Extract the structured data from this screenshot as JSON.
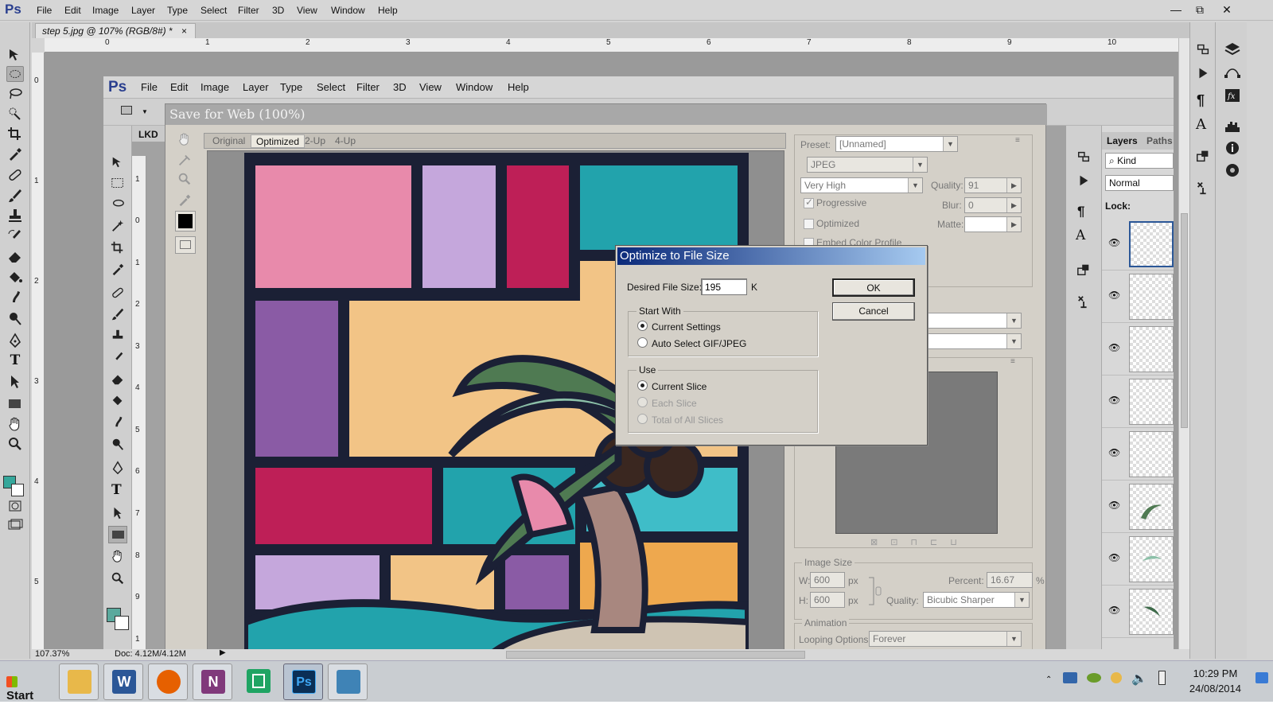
{
  "app": {
    "logo": "Ps",
    "menu": [
      "File",
      "Edit",
      "Image",
      "Layer",
      "Type",
      "Select",
      "Filter",
      "3D",
      "View",
      "Window",
      "Help"
    ],
    "window_controls": [
      "—",
      "⧉",
      "✕"
    ]
  },
  "document": {
    "tab_title": "step 5.jpg @ 107% (RGB/8#) *",
    "tab_close": "×",
    "ruler_h": [
      "0",
      "1",
      "2",
      "3",
      "4",
      "5",
      "6",
      "7",
      "8",
      "9",
      "10"
    ],
    "ruler_v": [
      "0",
      "1",
      "2",
      "3",
      "4",
      "5"
    ],
    "zoom": "107.37%",
    "doc_size": "Doc: 4.12M/4.12M"
  },
  "inner_screenshot": {
    "logo": "Ps",
    "menu": [
      "File",
      "Edit",
      "Image",
      "Layer",
      "Type",
      "Select",
      "Filter",
      "3D",
      "View",
      "Window",
      "Help"
    ],
    "lkd_label": "LKD",
    "ruler_v": [
      "1",
      "0",
      "1",
      "2",
      "3",
      "4",
      "5",
      "6",
      "7",
      "8",
      "9",
      "1"
    ],
    "layers_tab": "Layers",
    "paths_tab": "Paths",
    "kind_label": "Kind",
    "blend_mode": "Normal",
    "lock_label": "Lock:"
  },
  "save_for_web": {
    "title": "Save for Web (100%)",
    "view_tabs": [
      "Original",
      "Optimized",
      "2-Up",
      "4-Up"
    ],
    "active_tab": "Optimized",
    "preset_label": "Preset:",
    "preset_value": "[Unnamed]",
    "format_value": "JPEG",
    "quality_preset": "Very High",
    "quality_label": "Quality:",
    "quality_value": "91",
    "blur_label": "Blur:",
    "blur_value": "0",
    "matte_label": "Matte:",
    "progressive_label": "Progressive",
    "optimized_label": "Optimized",
    "embed_label": "Embed Color Profile",
    "image_size_label": "Image Size",
    "w_label": "W:",
    "w_value": "600",
    "h_label": "H:",
    "h_value": "600",
    "px_unit": "px",
    "percent_label": "Percent:",
    "percent_value": "16.67",
    "percent_unit": "%",
    "resample_label": "Quality:",
    "resample_value": "Bicubic Sharper",
    "animation_label": "Animation",
    "looping_label": "Looping Options:",
    "looping_value": "Forever"
  },
  "optimize_dialog": {
    "title": "Optimize to File Size",
    "desired_label": "Desired File Size:",
    "desired_value": "195",
    "unit": "K",
    "ok_label": "OK",
    "cancel_label": "Cancel",
    "start_with_label": "Start With",
    "current_settings_label": "Current Settings",
    "auto_select_label": "Auto Select GIF/JPEG",
    "use_label": "Use",
    "current_slice_label": "Current Slice",
    "each_slice_label": "Each Slice",
    "total_slices_label": "Total of All Slices",
    "start_with_selected": "Current Settings",
    "use_selected": "Current Slice"
  },
  "taskbar": {
    "start_label": "Start",
    "apps": [
      {
        "name": "file-explorer",
        "glyph": "",
        "color": "#e8b84a"
      },
      {
        "name": "word",
        "glyph": "W",
        "color": "#2b5797"
      },
      {
        "name": "firefox",
        "glyph": "",
        "color": "#e66000"
      },
      {
        "name": "onenote",
        "glyph": "N",
        "color": "#80397b"
      },
      {
        "name": "sheets",
        "glyph": "",
        "color": "#1fa463"
      },
      {
        "name": "photoshop",
        "glyph": "Ps",
        "color": "#0b2f56"
      },
      {
        "name": "photo-viewer",
        "glyph": "",
        "color": "#3f83b6"
      }
    ],
    "time": "10:29 PM",
    "date": "24/08/2014"
  },
  "colors": {
    "foreground_swatch": "#36a79b",
    "background_swatch": "#ffffff",
    "dialog_title_gradient_start": "#0b2a7a",
    "art_outline": "#1b2035"
  }
}
